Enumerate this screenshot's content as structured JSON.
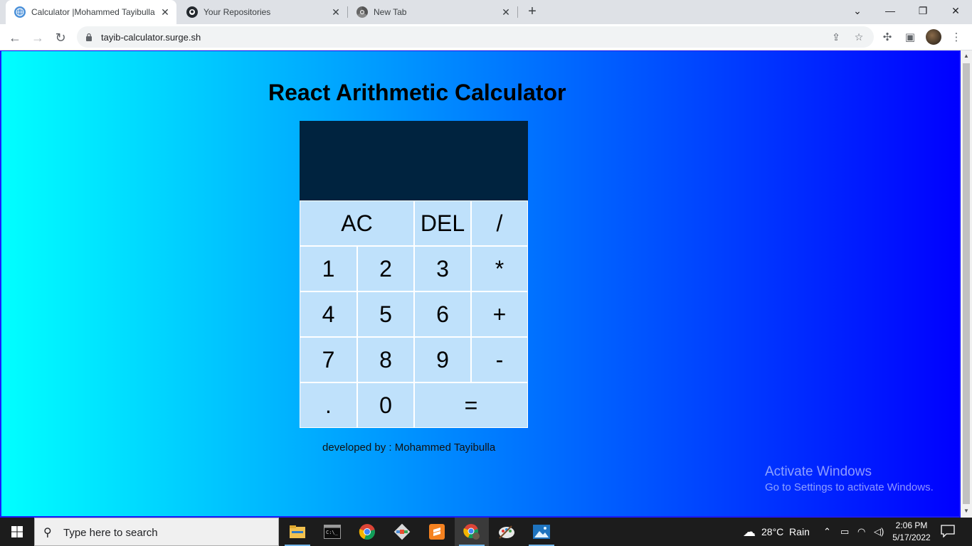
{
  "browser": {
    "tabs": [
      {
        "title": "Calculator |Mohammed Tayibulla",
        "favicon": "globe-icon",
        "active": true
      },
      {
        "title": "Your Repositories",
        "favicon": "github-icon",
        "active": false
      },
      {
        "title": "New Tab",
        "favicon": "chrome-icon",
        "active": false
      }
    ],
    "url": "tayib-calculator.surge.sh",
    "window_controls": {
      "chevron": "⌄",
      "minimize": "—",
      "restore": "❐",
      "close": "✕"
    }
  },
  "page": {
    "title": "React Arithmetic Calculator",
    "display_value": "",
    "keys": {
      "ac": "AC",
      "del": "DEL",
      "div": "/",
      "k1": "1",
      "k2": "2",
      "k3": "3",
      "mul": "*",
      "k4": "4",
      "k5": "5",
      "k6": "6",
      "add": "+",
      "k7": "7",
      "k8": "8",
      "k9": "9",
      "sub": "-",
      "dot": ".",
      "k0": "0",
      "eq": "="
    },
    "credit": "developed by : Mohammed Tayibulla",
    "colors": {
      "gradient_start": "#00ffff",
      "gradient_end": "#0000ff",
      "display_bg": "#00233f",
      "key_bg": "#bfe1fb"
    }
  },
  "watermark": {
    "line1": "Activate Windows",
    "line2": "Go to Settings to activate Windows."
  },
  "taskbar": {
    "search_placeholder": "Type here to search",
    "apps": [
      "file-explorer-icon",
      "terminal-icon",
      "chrome-icon",
      "git-icon",
      "sublime-text-icon",
      "chrome-profile-icon",
      "paint-icon",
      "photos-icon"
    ],
    "weather": "28°C  Rain",
    "time": "2:06 PM",
    "date": "5/17/2022"
  }
}
